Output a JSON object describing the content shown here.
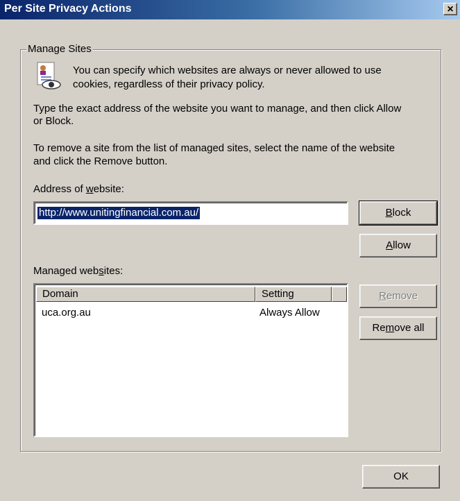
{
  "window": {
    "title": "Per Site Privacy Actions",
    "close_glyph": "×"
  },
  "group": {
    "legend": "Manage Sites"
  },
  "info": {
    "line1": "You can specify which websites are always or never allowed to use",
    "line2": "cookies, regardless of their privacy policy."
  },
  "instructions": {
    "p1_line1": "Type the exact address of the website you want to manage, and then click Allow",
    "p1_line2": "or Block.",
    "p2_line1": "To remove a site from the list of managed sites, select the name of the website",
    "p2_line2": "and click the Remove button."
  },
  "address": {
    "label_pre": "Address of ",
    "label_u": "w",
    "label_post": "ebsite:",
    "value": "http://www.unitingfinancial.com.au/"
  },
  "buttons": {
    "block_u": "B",
    "block_rest": "lock",
    "allow_u": "A",
    "allow_rest": "llow",
    "remove_u": "R",
    "remove_rest": "emove",
    "remove_all_pre": "Re",
    "remove_all_u": "m",
    "remove_all_post": "ove all",
    "ok": "OK"
  },
  "managed": {
    "label_pre": "Managed web",
    "label_u": "s",
    "label_post": "ites:",
    "columns": [
      "Domain",
      "Setting"
    ],
    "rows": [
      {
        "domain": "uca.org.au",
        "setting": "Always Allow"
      }
    ]
  },
  "icons": {
    "privacy": "privacy-document-eye-icon"
  }
}
